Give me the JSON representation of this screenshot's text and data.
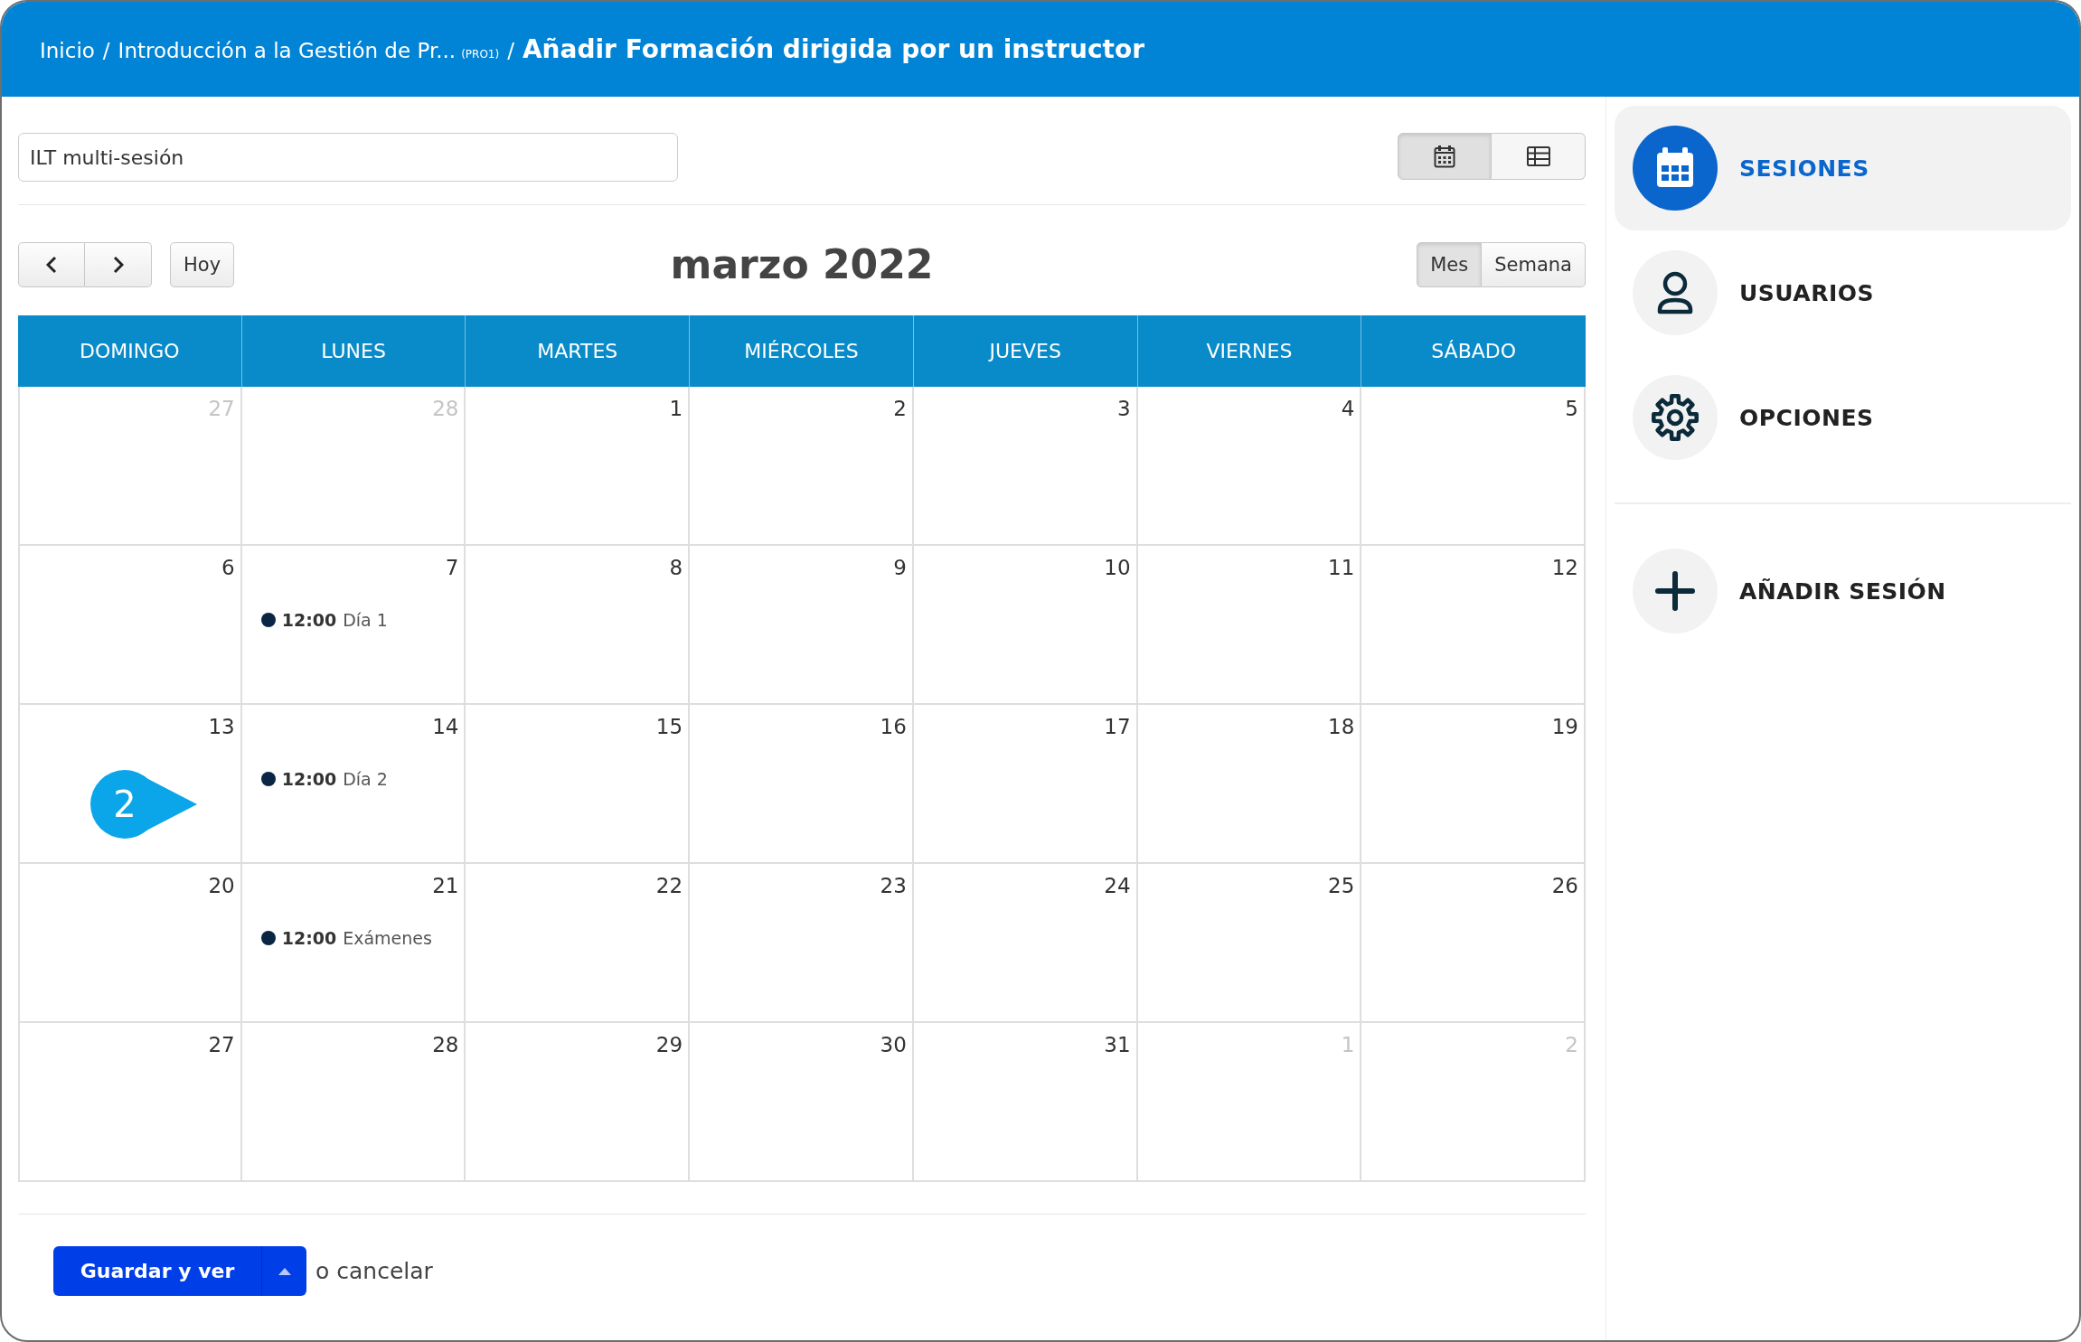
{
  "header": {
    "breadcrumbs": [
      {
        "label": "Inicio",
        "separator": "/"
      },
      {
        "label": "Introducción a la Gestión de Pr...",
        "code": "(PRO1)",
        "separator": "/"
      }
    ],
    "title": "Añadir Formación dirigida por un instructor"
  },
  "title_field": {
    "value": "ILT multi-sesión"
  },
  "view_toggle": [
    {
      "kind": "calendar",
      "selected": true
    },
    {
      "kind": "table",
      "selected": false
    }
  ],
  "calendar": {
    "nav": [
      {
        "kind": "prev"
      },
      {
        "kind": "next"
      }
    ],
    "today_button": "Hoy",
    "title": "marzo 2022",
    "modes": [
      {
        "label": "Mes",
        "selected": true
      },
      {
        "label": "Semana",
        "selected": false
      }
    ],
    "weekdays": [
      "DOMINGO",
      "LUNES",
      "MARTES",
      "MIÉRCOLES",
      "JUEVES",
      "VIERNES",
      "SÁBADO"
    ],
    "weeks": [
      [
        {
          "number": "27",
          "other_month": true
        },
        {
          "number": "28",
          "other_month": true
        },
        {
          "number": "1",
          "other_month": false
        },
        {
          "number": "2",
          "other_month": false
        },
        {
          "number": "3",
          "other_month": false
        },
        {
          "number": "4",
          "other_month": false
        },
        {
          "number": "5",
          "other_month": false
        }
      ],
      [
        {
          "number": "6",
          "other_month": false
        },
        {
          "number": "7",
          "other_month": false,
          "events": [
            {
              "time": "12:00",
              "title": "Día 1"
            }
          ]
        },
        {
          "number": "8",
          "other_month": false
        },
        {
          "number": "9",
          "other_month": false
        },
        {
          "number": "10",
          "other_month": false
        },
        {
          "number": "11",
          "other_month": false
        },
        {
          "number": "12",
          "other_month": false
        }
      ],
      [
        {
          "number": "13",
          "other_month": false,
          "callout": "2"
        },
        {
          "number": "14",
          "other_month": false,
          "events": [
            {
              "time": "12:00",
              "title": "Día 2"
            }
          ]
        },
        {
          "number": "15",
          "other_month": false
        },
        {
          "number": "16",
          "other_month": false
        },
        {
          "number": "17",
          "other_month": false
        },
        {
          "number": "18",
          "other_month": false
        },
        {
          "number": "19",
          "other_month": false
        }
      ],
      [
        {
          "number": "20",
          "other_month": false
        },
        {
          "number": "21",
          "other_month": false,
          "events": [
            {
              "time": "12:00",
              "title": "Exámenes"
            }
          ]
        },
        {
          "number": "22",
          "other_month": false
        },
        {
          "number": "23",
          "other_month": false
        },
        {
          "number": "24",
          "other_month": false
        },
        {
          "number": "25",
          "other_month": false
        },
        {
          "number": "26",
          "other_month": false
        }
      ],
      [
        {
          "number": "27",
          "other_month": false
        },
        {
          "number": "28",
          "other_month": false
        },
        {
          "number": "29",
          "other_month": false
        },
        {
          "number": "30",
          "other_month": false
        },
        {
          "number": "31",
          "other_month": false
        },
        {
          "number": "1",
          "other_month": true
        },
        {
          "number": "2",
          "other_month": true
        }
      ]
    ]
  },
  "footer": {
    "save_button": "Guardar y ver",
    "cancel_text": "o cancelar"
  },
  "sidebar": {
    "items": [
      {
        "label": "SESIONES",
        "kind": "calendar",
        "selected": true
      },
      {
        "label": "USUARIOS",
        "kind": "user",
        "selected": false
      },
      {
        "label": "OPCIONES",
        "kind": "gear",
        "selected": false
      }
    ],
    "actions": [
      {
        "label": "AÑADIR SESIÓN",
        "kind": "plus"
      }
    ]
  }
}
